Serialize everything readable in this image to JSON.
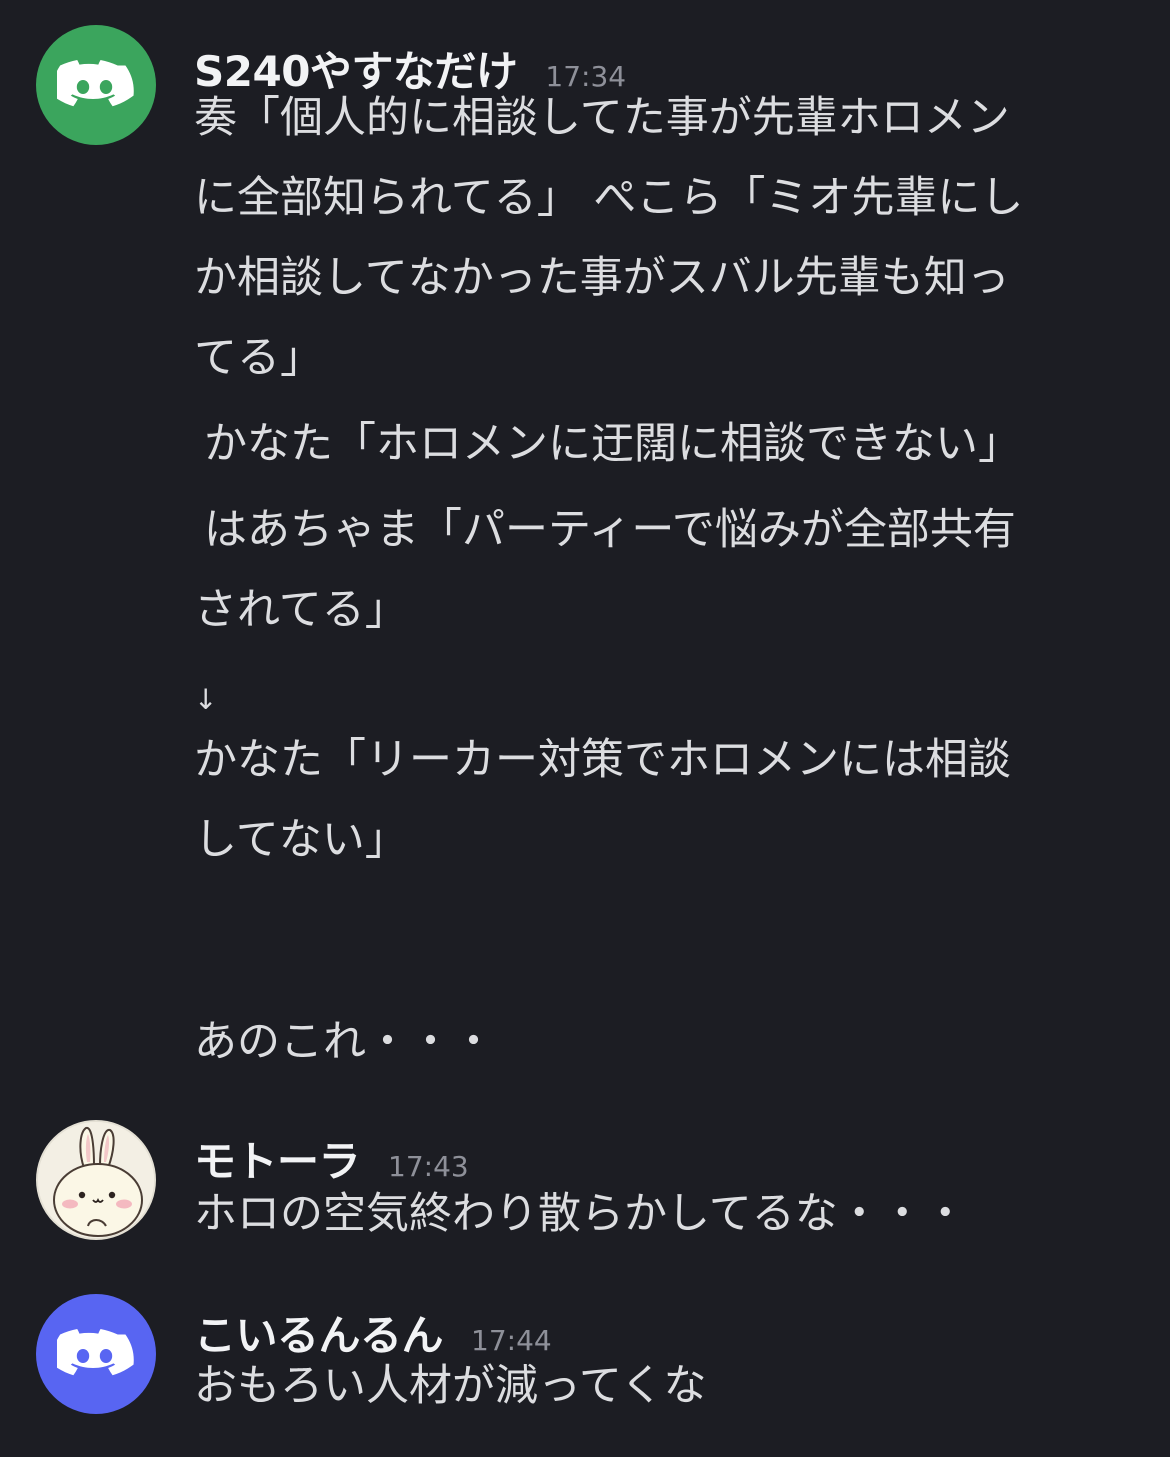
{
  "messages": [
    {
      "username": "S240やすなだけ",
      "time": "17:34",
      "avatar": {
        "type": "discord-default",
        "color": "#3ba55d"
      },
      "lines": [
        "奏「個人的に相談してた事が先輩ホロメン",
        "に全部知られてる」 ぺこら「ミオ先輩にし",
        "か相談してなかった事がスバル先輩も知っ",
        "てる」",
        "かなた「ホロメンに迂闊に相談できない」",
        "はあちゃま「パーティーで悩みが全部共有",
        "されてる」",
        "↓",
        "かなた「リーカー対策でホロメンには相談",
        "してない」",
        "あのこれ・・・"
      ]
    },
    {
      "username": "モトーラ",
      "time": "17:43",
      "avatar": {
        "type": "rabbit-character",
        "color": "#f3efe4"
      },
      "lines": [
        "ホロの空気終わり散らかしてるな・・・"
      ]
    },
    {
      "username": "こいるんるん",
      "time": "17:44",
      "avatar": {
        "type": "discord-default",
        "color": "#5865f2"
      },
      "lines": [
        "おもろい人材が減ってくな"
      ]
    }
  ]
}
